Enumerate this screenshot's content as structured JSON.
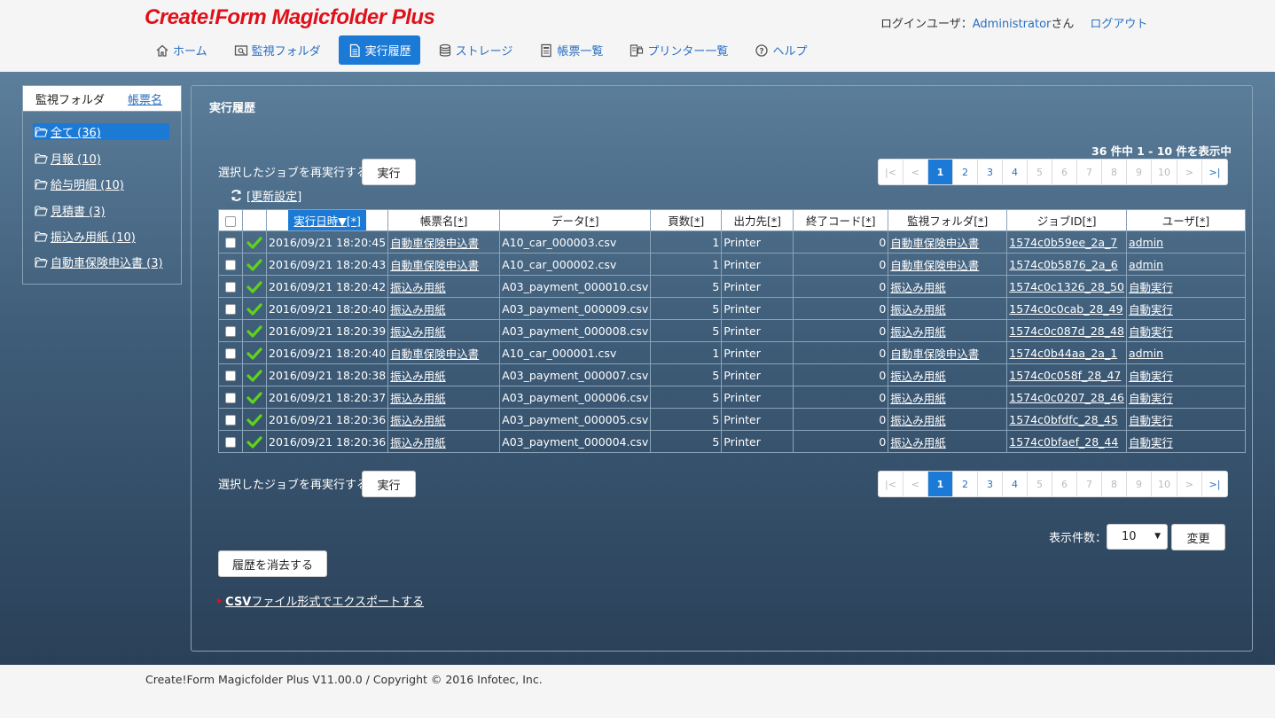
{
  "header": {
    "logo": "Create!Form Magicfolder Plus",
    "login_label": "ログインユーザ：",
    "username": "Administrator",
    "user_suffix": "さん",
    "logout": "ログアウト"
  },
  "nav": [
    {
      "label": "ホーム",
      "icon": "home-icon",
      "active": false
    },
    {
      "label": "監視フォルダ",
      "icon": "watch-folder-icon",
      "active": false
    },
    {
      "label": "実行履歴",
      "icon": "document-icon",
      "active": true
    },
    {
      "label": "ストレージ",
      "icon": "database-icon",
      "active": false
    },
    {
      "label": "帳票一覧",
      "icon": "form-list-icon",
      "active": false
    },
    {
      "label": "プリンター一覧",
      "icon": "printer-icon",
      "active": false
    },
    {
      "label": "ヘルプ",
      "icon": "help-icon",
      "active": false
    }
  ],
  "sidebar": {
    "tab_folder": "監視フォルダ",
    "tab_form": "帳票名",
    "items": [
      {
        "label": "全て (36)",
        "selected": true
      },
      {
        "label": "月報 (10)",
        "selected": false
      },
      {
        "label": "給与明細 (10)",
        "selected": false
      },
      {
        "label": "見積書 (3)",
        "selected": false
      },
      {
        "label": "振込み用紙 (10)",
        "selected": false
      },
      {
        "label": "自動車保険申込書 (3)",
        "selected": false
      }
    ]
  },
  "panel": {
    "title": "実行履歴",
    "count_text": "36 件中 1 - 10 件を表示中",
    "rerun_label": "選択したジョブを再実行する",
    "run_button": "実行",
    "refresh_settings": "[更新設定]",
    "pager": [
      "|<",
      "<",
      "1",
      "2",
      "3",
      "4",
      "5",
      "6",
      "7",
      "8",
      "9",
      "10",
      ">",
      ">|"
    ],
    "pager_current": "1",
    "display_count_label": "表示件数：",
    "display_count_value": "10",
    "change_button": "変更",
    "clear_history_button": "履歴を消去する",
    "export_prefix": "CSV",
    "export_rest": "ファイル形式でエクスポートする"
  },
  "table": {
    "headers": {
      "datetime": "実行日時▼",
      "form": "帳票名",
      "data": "データ",
      "pages": "頁数",
      "output": "出力先",
      "exitcode": "終了コード",
      "folder": "監視フォルダ",
      "jobid": "ジョブID",
      "user": "ユーザ",
      "star": "[*]"
    },
    "rows": [
      {
        "datetime": "2016/09/21 18:20:45",
        "form": "自動車保険申込書",
        "data": "A10_car_000003.csv",
        "pages": "1",
        "output": "Printer",
        "exitcode": "0",
        "folder": "自動車保険申込書",
        "jobid": "1574c0b59ee_2a_7",
        "user": "admin"
      },
      {
        "datetime": "2016/09/21 18:20:43",
        "form": "自動車保険申込書",
        "data": "A10_car_000002.csv",
        "pages": "1",
        "output": "Printer",
        "exitcode": "0",
        "folder": "自動車保険申込書",
        "jobid": "1574c0b5876_2a_6",
        "user": "admin"
      },
      {
        "datetime": "2016/09/21 18:20:42",
        "form": "振込み用紙",
        "data": "A03_payment_000010.csv",
        "pages": "5",
        "output": "Printer",
        "exitcode": "0",
        "folder": "振込み用紙",
        "jobid": "1574c0c1326_28_50",
        "user": "自動実行"
      },
      {
        "datetime": "2016/09/21 18:20:40",
        "form": "振込み用紙",
        "data": "A03_payment_000009.csv",
        "pages": "5",
        "output": "Printer",
        "exitcode": "0",
        "folder": "振込み用紙",
        "jobid": "1574c0c0cab_28_49",
        "user": "自動実行"
      },
      {
        "datetime": "2016/09/21 18:20:39",
        "form": "振込み用紙",
        "data": "A03_payment_000008.csv",
        "pages": "5",
        "output": "Printer",
        "exitcode": "0",
        "folder": "振込み用紙",
        "jobid": "1574c0c087d_28_48",
        "user": "自動実行"
      },
      {
        "datetime": "2016/09/21 18:20:40",
        "form": "自動車保険申込書",
        "data": "A10_car_000001.csv",
        "pages": "1",
        "output": "Printer",
        "exitcode": "0",
        "folder": "自動車保険申込書",
        "jobid": "1574c0b44aa_2a_1",
        "user": "admin"
      },
      {
        "datetime": "2016/09/21 18:20:38",
        "form": "振込み用紙",
        "data": "A03_payment_000007.csv",
        "pages": "5",
        "output": "Printer",
        "exitcode": "0",
        "folder": "振込み用紙",
        "jobid": "1574c0c058f_28_47",
        "user": "自動実行"
      },
      {
        "datetime": "2016/09/21 18:20:37",
        "form": "振込み用紙",
        "data": "A03_payment_000006.csv",
        "pages": "5",
        "output": "Printer",
        "exitcode": "0",
        "folder": "振込み用紙",
        "jobid": "1574c0c0207_28_46",
        "user": "自動実行"
      },
      {
        "datetime": "2016/09/21 18:20:36",
        "form": "振込み用紙",
        "data": "A03_payment_000005.csv",
        "pages": "5",
        "output": "Printer",
        "exitcode": "0",
        "folder": "振込み用紙",
        "jobid": "1574c0bfdfc_28_45",
        "user": "自動実行"
      },
      {
        "datetime": "2016/09/21 18:20:36",
        "form": "振込み用紙",
        "data": "A03_payment_000004.csv",
        "pages": "5",
        "output": "Printer",
        "exitcode": "0",
        "folder": "振込み用紙",
        "jobid": "1574c0bfaef_28_44",
        "user": "自動実行"
      }
    ]
  },
  "footer": {
    "copyright": "Create!Form Magicfolder Plus V11.00.0 / Copyright © 2016 Infotec, Inc."
  },
  "colors": {
    "accent": "#1b7ad6",
    "logo": "#e0101a",
    "link": "#2a6fc2",
    "success": "#5fd31a"
  }
}
